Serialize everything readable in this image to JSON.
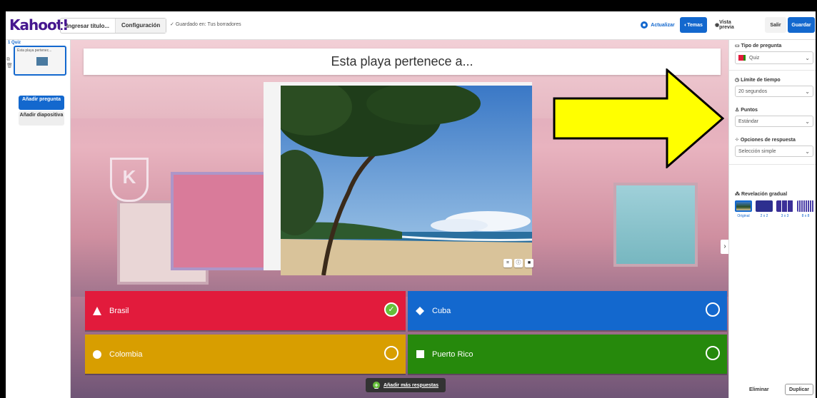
{
  "app": {
    "logo": "Kahoot!"
  },
  "topbar": {
    "title_placeholder": "Ingresar título...",
    "config_label": "Configuración",
    "saved_status": "Guardado en: Tus borradores",
    "update_label": "Actualizar",
    "themes_label": "Temas",
    "preview_label": "Vista previa",
    "exit_label": "Salir",
    "save_label": "Guardar"
  },
  "sidebar": {
    "slide_label": "1 Quiz",
    "slide_preview_text": "Esta playa pertenec...",
    "add_question_label": "Añadir pregunta",
    "add_slide_label": "Añadir diapositiva"
  },
  "question": {
    "text": "Esta playa pertenece a...",
    "add_more_answers_label": "Añadir más respuestas",
    "answers": [
      {
        "text": "Brasil",
        "correct": true,
        "color": "#e21b3c",
        "shape": "triangle"
      },
      {
        "text": "Cuba",
        "correct": false,
        "color": "#1368ce",
        "shape": "diamond"
      },
      {
        "text": "Colombia",
        "correct": false,
        "color": "#d89e00",
        "shape": "circle"
      },
      {
        "text": "Puerto Rico",
        "correct": false,
        "color": "#26890c",
        "shape": "square"
      }
    ]
  },
  "settings": {
    "question_type_label": "Tipo de pregunta",
    "question_type_value": "Quiz",
    "time_limit_label": "Límite de tiempo",
    "time_limit_value": "20 segundos",
    "points_label": "Puntos",
    "points_value": "Estándar",
    "answer_options_label": "Opciones de respuesta",
    "answer_options_value": "Selección simple",
    "reveal_label": "Revelación gradual",
    "reveal_options": [
      "Original",
      "2 x 2",
      "3 x 3",
      "8 x 8"
    ],
    "delete_label": "Eliminar",
    "duplicate_label": "Duplicar"
  },
  "colors": {
    "brand": "#46178f",
    "accent": "#1368ce",
    "annotation_arrow": "#ffff00"
  }
}
